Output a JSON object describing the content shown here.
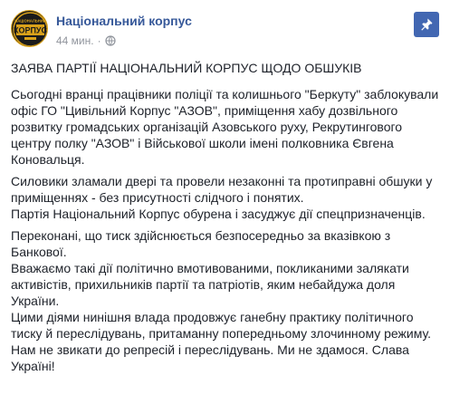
{
  "post": {
    "author": "Національний корпус",
    "timestamp": "44 мин.",
    "separator": "·",
    "privacy_icon": "globe-icon",
    "pin_icon": "pin-icon",
    "avatar_text": "НАЦІОНАЛЬНИЙ КОРПУС",
    "avatar_word_top": "НАЦІОНАЛЬНИЙ",
    "avatar_word_main": "КОРПУС",
    "paragraphs": [
      "ЗАЯВА ПАРТІЇ НАЦІОНАЛЬНИЙ КОРПУС ЩОДО ОБШУКІВ",
      "Сьогодні вранці працівники поліції та колишнього \"Беркуту\" заблокували\nофіс ГО \"Цивільний Корпус \"АЗОВ\", приміщення хабу дозвільного\nрозвитку громадських організацій Азовського руху, Рекрутингового\nцентру полку \"АЗОВ\" і Військової школи імені полковника Євгена\nКоновальця.",
      "Силовики зламали двері та провели незаконні та протиправні обшуки у\nприміщеннях - без присутності слідчого і понятих.\nПартія Національний Корпус обурена і засуджує дії спецпризначенців.",
      "Переконані, що тиск здійснюється безпосередньо за вказівкою з\nБанкової.",
      "Вважаємо такі дії політично вмотивованими, покликаними залякати\nактивістів, прихильників партії та патріотів, яким небайдужа доля\nУкраїни.",
      "Цими діями нинішня влада продовжує ганебну практику політичного\nтиску й переслідувань, притаманну попередньому злочинному режиму.\nНам не звикати до репресій і переслідувань. Ми не здамося. Слава\nУкраїні!"
    ]
  },
  "colors": {
    "author_link": "#365899",
    "meta_gray": "#90949c",
    "text": "#1d2129",
    "pin_button": "#4267b2",
    "avatar_gold": "#d9a11a",
    "avatar_dark": "#1b1b1b"
  }
}
